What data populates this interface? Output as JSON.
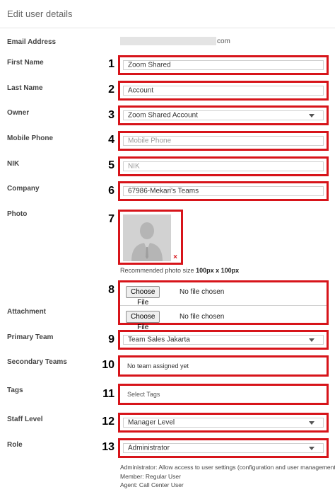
{
  "header": {
    "title": "Edit user details"
  },
  "email": {
    "label": "Email Address",
    "suffix": "com"
  },
  "fields": {
    "first_name": {
      "label": "First Name",
      "marker": "1",
      "value": "Zoom Shared"
    },
    "last_name": {
      "label": "Last Name",
      "marker": "2",
      "value": "Account"
    },
    "owner": {
      "label": "Owner",
      "marker": "3",
      "value": "Zoom Shared Account"
    },
    "mobile_phone": {
      "label": "Mobile Phone",
      "marker": "4",
      "placeholder": "Mobile Phone"
    },
    "nik": {
      "label": "NIK",
      "marker": "5",
      "placeholder": "NIK"
    },
    "company": {
      "label": "Company",
      "marker": "6",
      "value": "67986-Mekari's Teams"
    },
    "photo": {
      "label": "Photo",
      "marker": "7",
      "remove_icon": "×",
      "note_prefix": "Recommended photo size",
      "note_size": "100px x 100px"
    },
    "attachment": {
      "label": "Attachment",
      "marker": "8",
      "button_label": "Choose File",
      "status": "No file chosen"
    },
    "primary_team": {
      "label": "Primary Team",
      "marker": "9",
      "value": "Team Sales Jakarta"
    },
    "secondary_teams": {
      "label": "Secondary Teams",
      "marker": "10",
      "value": "No team assigned yet"
    },
    "tags": {
      "label": "Tags",
      "marker": "11",
      "placeholder": "Select Tags"
    },
    "staff_level": {
      "label": "Staff Level",
      "marker": "12",
      "value": "Manager Level"
    },
    "role": {
      "label": "Role",
      "marker": "13",
      "value": "Administrator",
      "help": [
        "Administrator: Allow access to user settings (configuration and user management)",
        "Member: Regular User",
        "Agent: Call Center User"
      ]
    }
  },
  "colors": {
    "highlight_border": "#d7141a",
    "input_border": "#d0d0d0",
    "placeholder": "#9a9a9a"
  },
  "icons": {
    "dropdown": "chevron-down-icon",
    "avatar": "user-silhouette-icon",
    "remove": "close-icon"
  }
}
